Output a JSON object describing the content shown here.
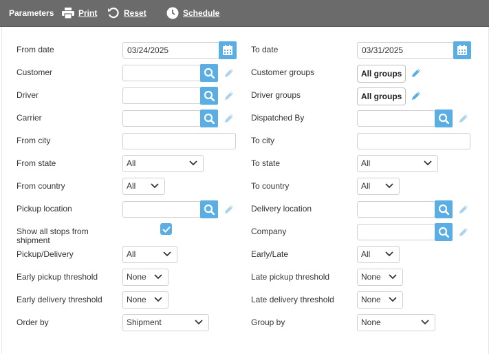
{
  "toolbar": {
    "title": "Parameters",
    "print": "Print",
    "reset": "Reset",
    "schedule": "Schedule"
  },
  "form": {
    "from_date": {
      "label": "From date",
      "value": "03/24/2025"
    },
    "to_date": {
      "label": "To date",
      "value": "03/31/2025"
    },
    "customer": {
      "label": "Customer",
      "value": ""
    },
    "customer_groups": {
      "label": "Customer groups",
      "value": "All groups"
    },
    "driver": {
      "label": "Driver",
      "value": ""
    },
    "driver_groups": {
      "label": "Driver groups",
      "value": "All groups"
    },
    "carrier": {
      "label": "Carrier",
      "value": ""
    },
    "dispatched_by": {
      "label": "Dispatched By",
      "value": ""
    },
    "from_city": {
      "label": "From city",
      "value": ""
    },
    "to_city": {
      "label": "To city",
      "value": ""
    },
    "from_state": {
      "label": "From state",
      "value": "All"
    },
    "to_state": {
      "label": "To state",
      "value": "All"
    },
    "from_country": {
      "label": "From country",
      "value": "All"
    },
    "to_country": {
      "label": "To country",
      "value": "All"
    },
    "pickup_location": {
      "label": "Pickup location",
      "value": ""
    },
    "delivery_location": {
      "label": "Delivery location",
      "value": ""
    },
    "show_all_stops": {
      "label_line1": "Show all stops from",
      "label_line2": "shipment",
      "checked": true
    },
    "company": {
      "label": "Company",
      "value": ""
    },
    "pickup_delivery": {
      "label": "Pickup/Delivery",
      "value": "All"
    },
    "early_late": {
      "label": "Early/Late",
      "value": "All"
    },
    "early_pickup_threshold": {
      "label": "Early pickup threshold",
      "value": "None"
    },
    "late_pickup_threshold": {
      "label": "Late pickup threshold",
      "value": "None"
    },
    "early_delivery_threshold": {
      "label": "Early delivery threshold",
      "value": "None"
    },
    "late_delivery_threshold": {
      "label": "Late delivery threshold",
      "value": "None"
    },
    "order_by": {
      "label": "Order by",
      "value": "Shipment"
    },
    "group_by": {
      "label": "Group by",
      "value": "None"
    }
  },
  "icons": {
    "print": "printer-icon",
    "reset": "reset-icon",
    "schedule": "clock-icon",
    "calendar": "calendar-icon",
    "search": "search-icon",
    "edit": "pencil-icon",
    "dropdown": "chevron-down-icon",
    "check": "check-icon"
  },
  "colors": {
    "toolbar_bg": "#6b6b6b",
    "accent": "#5aaee3"
  }
}
